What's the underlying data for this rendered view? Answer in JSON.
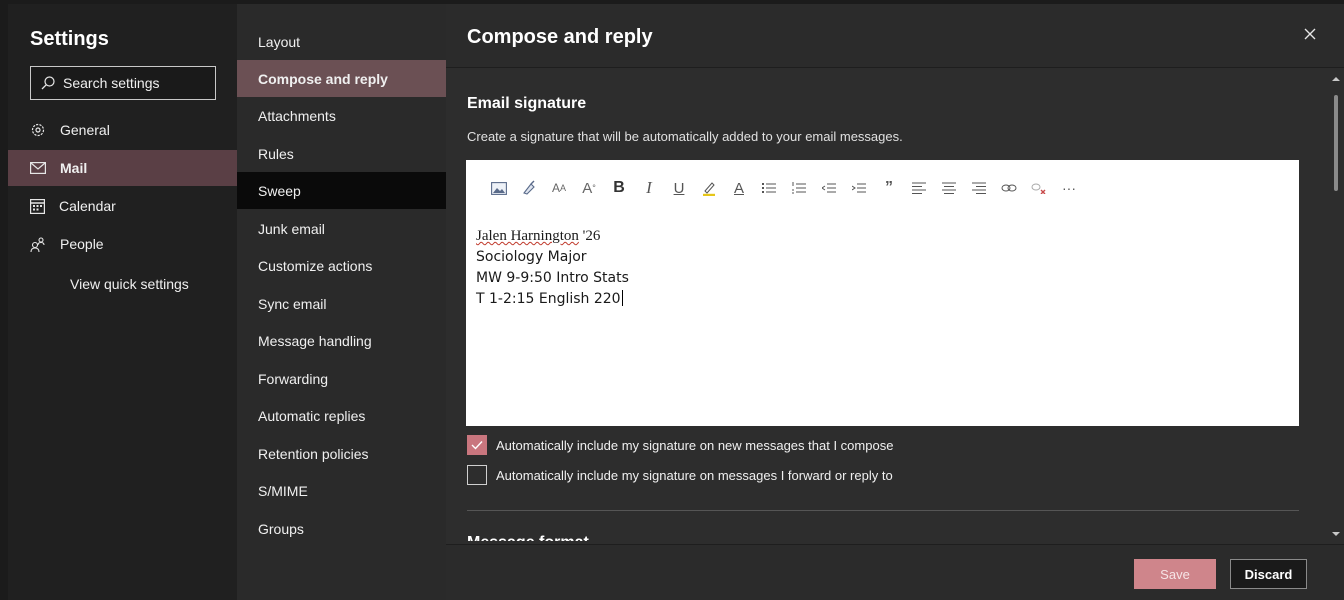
{
  "settings": {
    "title": "Settings",
    "search_placeholder": "Search settings",
    "nav": [
      {
        "label": "General",
        "icon": "gear-icon"
      },
      {
        "label": "Mail",
        "icon": "mail-icon"
      },
      {
        "label": "Calendar",
        "icon": "calendar-icon"
      },
      {
        "label": "People",
        "icon": "people-icon"
      }
    ],
    "quick_link": "View quick settings"
  },
  "mail_nav": [
    "Layout",
    "Compose and reply",
    "Attachments",
    "Rules",
    "Sweep",
    "Junk email",
    "Customize actions",
    "Sync email",
    "Message handling",
    "Forwarding",
    "Automatic replies",
    "Retention policies",
    "S/MIME",
    "Groups"
  ],
  "pane": {
    "title": "Compose and reply",
    "section_title": "Email signature",
    "section_desc": "Create a signature that will be automatically added to your email messages.",
    "signature": {
      "name": "Jalen Harnington",
      "class_year": " '26",
      "line2": "Sociology Major",
      "line3": "MW 9-9:50 Intro Stats",
      "line4": "T 1-2:15 English 220"
    },
    "toolbar_icons": [
      "insert-picture-icon",
      "format-painter-icon",
      "font-size-icon",
      "text-effects-icon",
      "bold-icon",
      "italic-icon",
      "underline-icon",
      "highlight-icon",
      "font-color-icon",
      "bullets-icon",
      "numbering-icon",
      "decrease-indent-icon",
      "increase-indent-icon",
      "quote-icon",
      "align-left-icon",
      "align-center-icon",
      "align-right-icon",
      "link-icon",
      "remove-link-icon",
      "more-options-icon"
    ],
    "check_new": {
      "label": "Automatically include my signature on new messages that I compose",
      "checked": true
    },
    "check_reply": {
      "label": "Automatically include my signature on messages I forward or reply to",
      "checked": false
    },
    "next_section_partial": "Message format"
  },
  "footer": {
    "save": "Save",
    "discard": "Discard"
  },
  "colors": {
    "accent": "#c9767e",
    "selected_nav": "#5a3f45",
    "selected_sub": "#6b5054"
  }
}
